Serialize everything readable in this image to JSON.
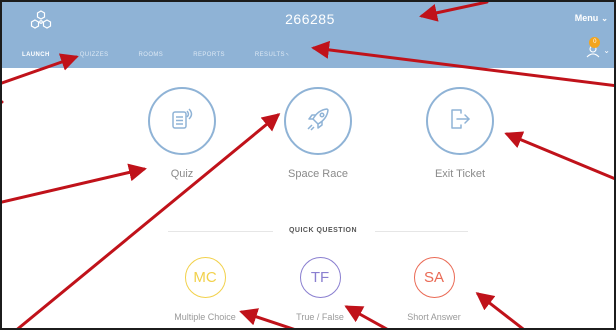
{
  "header": {
    "room_code": "266285",
    "menu_label": "Menu",
    "notification_count": "0"
  },
  "tabs": [
    {
      "label": "LAUNCH",
      "active": true
    },
    {
      "label": "QUIZZES",
      "active": false
    },
    {
      "label": "ROOMS",
      "active": false
    },
    {
      "label": "REPORTS",
      "active": false
    },
    {
      "label": "RESULTS",
      "active": false
    }
  ],
  "launch": {
    "quiz_label": "Quiz",
    "space_race_label": "Space Race",
    "exit_ticket_label": "Exit Ticket"
  },
  "quick_question": {
    "title": "QUICK QUESTION",
    "options": [
      {
        "abbr": "MC",
        "label": "Multiple Choice",
        "color": "#f2d14b"
      },
      {
        "abbr": "TF",
        "label": "True / False",
        "color": "#8a7fd0"
      },
      {
        "abbr": "SA",
        "label": "Short Answer",
        "color": "#ea6a55"
      }
    ]
  },
  "colors": {
    "header_bg": "#8fb3d6",
    "accent": "#8fb3d6",
    "annotation": "#c0121a",
    "badge": "#f3a51e"
  },
  "icons": [
    "logo-icon",
    "chevron-down-icon",
    "user-icon",
    "quiz-icon",
    "rocket-icon",
    "exit-icon"
  ]
}
